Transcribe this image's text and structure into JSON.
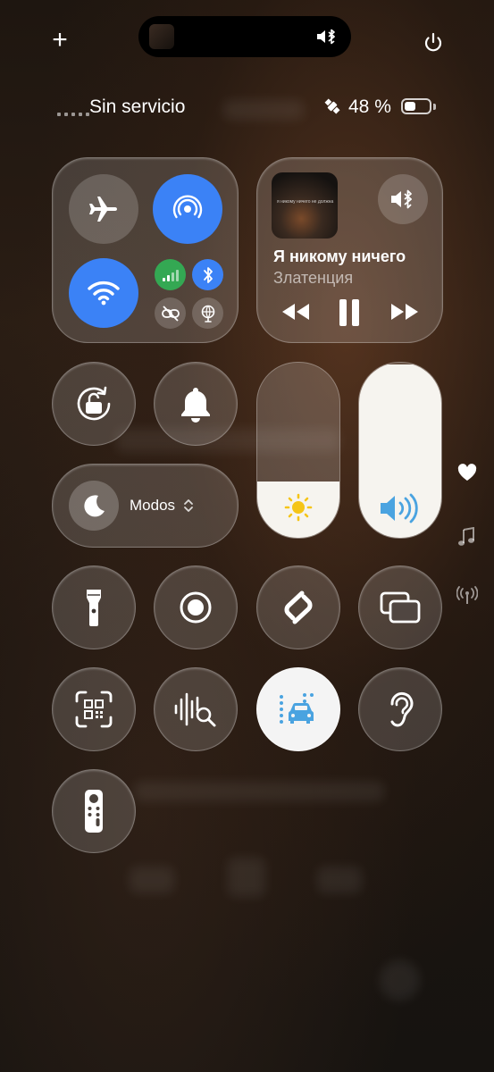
{
  "top_bar": {
    "add_label": "+"
  },
  "status": {
    "carrier": "Sin servicio",
    "battery_percent": "48 %",
    "battery_level": 0.48
  },
  "now_playing": {
    "album_art_text": "я никому ничего не должна",
    "title": "Я никому ничего",
    "artist": "Златенция"
  },
  "controls": {
    "modes_label": "Modos"
  },
  "sliders": {
    "brightness_level": 0.32,
    "volume_level": 0.99
  },
  "colors": {
    "accent_blue": "#3b82f6",
    "cellular_green": "#34a853",
    "sun_yellow": "#f5c518",
    "volume_blue": "#4aa3e0"
  },
  "icons": [
    "plus-icon",
    "power-icon",
    "bluetooth-speaker-icon",
    "airplane-icon",
    "airdrop-icon",
    "wifi-icon",
    "cellular-icon",
    "bluetooth-icon",
    "chain-link-icon",
    "globe-icon",
    "rewind-icon",
    "pause-icon",
    "fast-forward-icon",
    "rotation-lock-icon",
    "bell-icon",
    "moon-icon",
    "sun-icon",
    "speaker-volume-icon",
    "flashlight-icon",
    "screen-record-icon",
    "shazam-icon",
    "screen-mirroring-icon",
    "qr-scanner-icon",
    "sound-recognition-icon",
    "vehicle-motion-icon",
    "hearing-icon",
    "remote-icon",
    "heart-icon",
    "music-note-icon",
    "broadcast-icon"
  ]
}
